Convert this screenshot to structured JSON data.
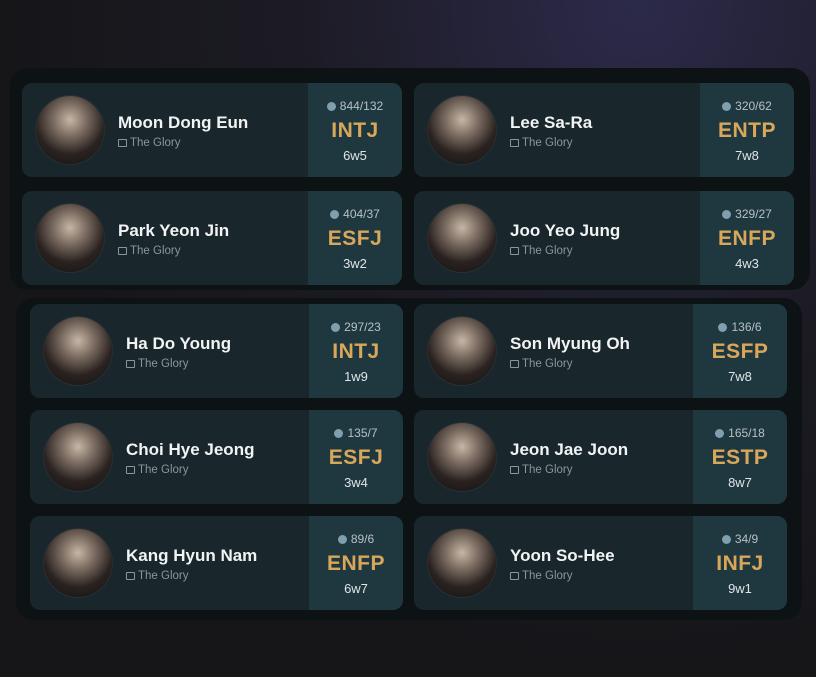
{
  "characters": [
    {
      "name": "Moon Dong Eun",
      "source": "The Glory",
      "votes": "844/132",
      "type": "INTJ",
      "wing": "6w5"
    },
    {
      "name": "Lee Sa-Ra",
      "source": "The Glory",
      "votes": "320/62",
      "type": "ENTP",
      "wing": "7w8"
    },
    {
      "name": "Park Yeon Jin",
      "source": "The Glory",
      "votes": "404/37",
      "type": "ESFJ",
      "wing": "3w2"
    },
    {
      "name": "Joo Yeo Jung",
      "source": "The Glory",
      "votes": "329/27",
      "type": "ENFP",
      "wing": "4w3"
    },
    {
      "name": "Ha Do Young",
      "source": "The Glory",
      "votes": "297/23",
      "type": "INTJ",
      "wing": "1w9"
    },
    {
      "name": "Son Myung Oh",
      "source": "The Glory",
      "votes": "136/6",
      "type": "ESFP",
      "wing": "7w8"
    },
    {
      "name": "Choi Hye Jeong",
      "source": "The Glory",
      "votes": "135/7",
      "type": "ESFJ",
      "wing": "3w4"
    },
    {
      "name": "Jeon Jae Joon",
      "source": "The Glory",
      "votes": "165/18",
      "type": "ESTP",
      "wing": "8w7"
    },
    {
      "name": "Kang Hyun Nam",
      "source": "The Glory",
      "votes": "89/6",
      "type": "ENFP",
      "wing": "6w7"
    },
    {
      "name": "Yoon So-Hee",
      "source": "The Glory",
      "votes": "34/9",
      "type": "INFJ",
      "wing": "9w1"
    }
  ],
  "colors": {
    "background": "#161619",
    "panel": "#0d1214",
    "card": "#19262b",
    "badge": "#1f3840",
    "type_text": "#d9a75a",
    "name_text": "#f1f3f4",
    "source_text": "#8b969a"
  },
  "icons": {
    "votes": "person-votes-icon",
    "source": "film-icon"
  }
}
